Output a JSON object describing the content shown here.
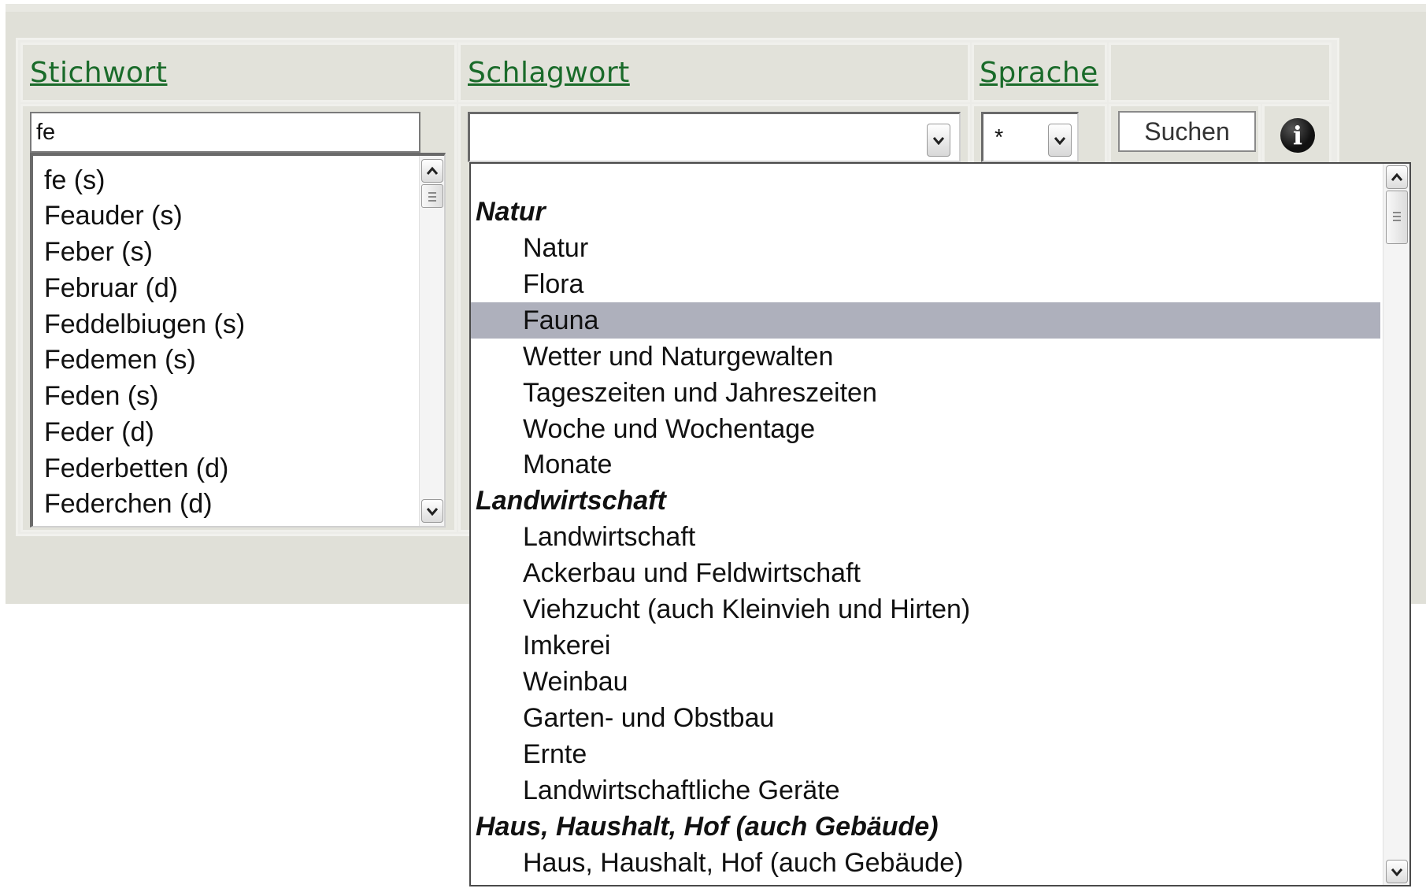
{
  "headers": {
    "stichwort": "Stichwort",
    "schlagwort": "Schlagwort",
    "sprache": "Sprache"
  },
  "stichwort_input": {
    "value": "fe"
  },
  "stichwort_list": {
    "items": [
      "fe (s)",
      "Feauder (s)",
      "Feber (s)",
      "Februar (d)",
      "Feddelbiugen (s)",
      "Fedemen (s)",
      "Feden (s)",
      "Feder (d)",
      "Federbetten (d)",
      "Federchen (d)"
    ]
  },
  "schlagwort_select": {
    "value": ""
  },
  "sprache_select": {
    "value": "*"
  },
  "search_button": {
    "label": "Suchen"
  },
  "info_button": {
    "glyph": "i"
  },
  "schlagwort_dropdown": {
    "selected": "Fauna",
    "items": [
      {
        "type": "blank",
        "label": ""
      },
      {
        "type": "group",
        "label": "Natur"
      },
      {
        "type": "option",
        "label": "Natur"
      },
      {
        "type": "option",
        "label": "Flora"
      },
      {
        "type": "option",
        "label": "Fauna",
        "selected": true
      },
      {
        "type": "option",
        "label": "Wetter und Naturgewalten"
      },
      {
        "type": "option",
        "label": "Tageszeiten und Jahreszeiten"
      },
      {
        "type": "option",
        "label": "Woche und Wochentage"
      },
      {
        "type": "option",
        "label": "Monate"
      },
      {
        "type": "group",
        "label": "Landwirtschaft"
      },
      {
        "type": "option",
        "label": "Landwirtschaft"
      },
      {
        "type": "option",
        "label": "Ackerbau und Feldwirtschaft"
      },
      {
        "type": "option",
        "label": "Viehzucht (auch Kleinvieh und Hirten)"
      },
      {
        "type": "option",
        "label": "Imkerei"
      },
      {
        "type": "option",
        "label": "Weinbau"
      },
      {
        "type": "option",
        "label": "Garten- und Obstbau"
      },
      {
        "type": "option",
        "label": "Ernte"
      },
      {
        "type": "option",
        "label": "Landwirtschaftliche Geräte"
      },
      {
        "type": "group",
        "label": "Haus, Haushalt, Hof (auch Gebäude)"
      },
      {
        "type": "option",
        "label": "Haus, Haushalt, Hof (auch Gebäude)"
      }
    ]
  },
  "colors": {
    "link": "#1a6b2a",
    "highlight": "#aeb0bc",
    "background": "#e0e0d8"
  },
  "icons": {
    "scroll_up": "chevron-up-icon",
    "scroll_down": "chevron-down-icon",
    "dropdown_arrow": "chevron-down-icon",
    "info": "info-icon"
  }
}
